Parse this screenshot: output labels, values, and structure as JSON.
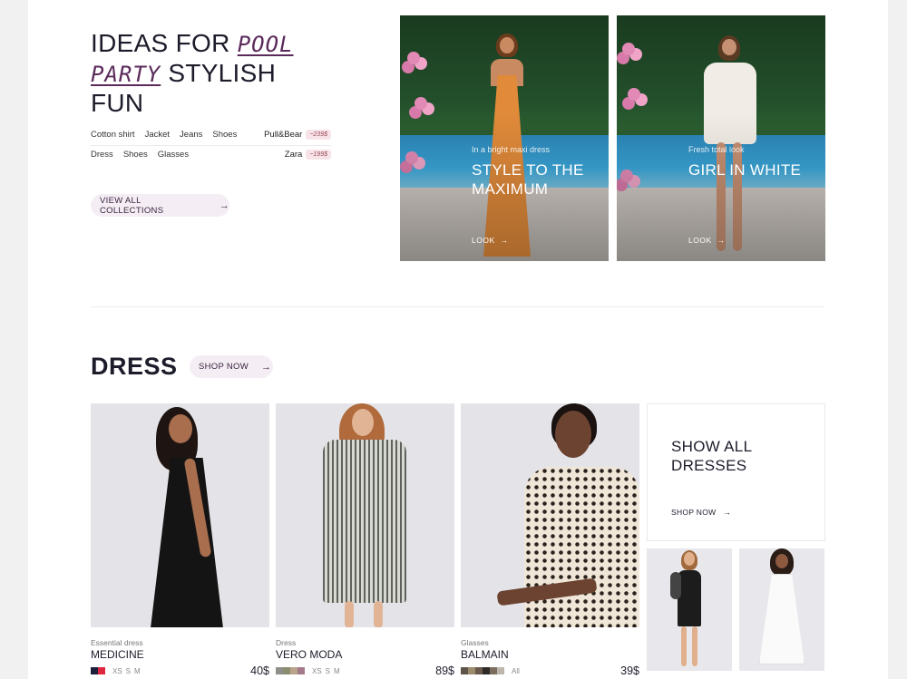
{
  "hero": {
    "title_line1": "Ideas for ",
    "title_hand1": "Pool",
    "title_hand2": "Party",
    "title_line2": " Stylish",
    "title_line3": "Fun",
    "outfits": [
      {
        "items": [
          "Cotton shirt",
          "Jacket",
          "Jeans",
          "Shoes"
        ],
        "brand": "Pull&Bear",
        "price": "~239$"
      },
      {
        "items": [
          "Dress",
          "Shoes",
          "Glasses"
        ],
        "brand": "Zara",
        "price": "~199$"
      }
    ],
    "view_all_label": "View all collections"
  },
  "cards": [
    {
      "subtitle": "In a bright maxi dress",
      "heading_line1": "Style to the",
      "heading_line2": "maximum",
      "look_label": "LOOK"
    },
    {
      "subtitle": "Fresh total look",
      "heading_line1": "Girl in white",
      "heading_line2": "",
      "look_label": "LOOK"
    }
  ],
  "dress_section": {
    "title": "DRESS",
    "shop_now_label": "Shop now"
  },
  "products": [
    {
      "category": "Essential dress",
      "name": "Medicine",
      "swatches": [
        "#1b1f3a",
        "#e0263f"
      ],
      "sizes": [
        "XS",
        "S",
        "M"
      ],
      "price": "40$"
    },
    {
      "category": "Dress",
      "name": "Vero Moda",
      "swatches": [
        "#8f8f8a",
        "#8c8c6f",
        "#b8a58a",
        "#a37b8a"
      ],
      "sizes": [
        "XS",
        "S",
        "M"
      ],
      "price": "89$"
    },
    {
      "category": "Glasses",
      "name": "Balmain",
      "swatches": [
        "#5e5448",
        "#9b8c6b",
        "#6a5a4d",
        "#2e2a28",
        "#7b6e5e",
        "#bdb6aa"
      ],
      "sizes": [
        "All"
      ],
      "price": "39$"
    }
  ],
  "show_all": {
    "title_line1": "Show all",
    "title_line2": "dresses",
    "shop_now_label": "Shop now"
  },
  "icons": {
    "arrow": "→"
  }
}
